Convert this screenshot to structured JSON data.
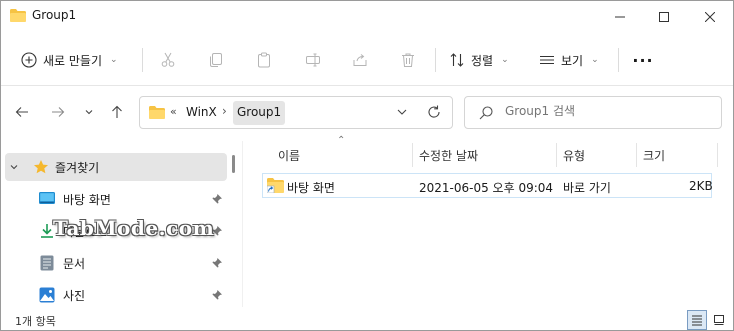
{
  "window": {
    "title": "Group1"
  },
  "toolbar": {
    "new_label": "새로 만들기",
    "sort_label": "정렬",
    "view_label": "보기",
    "more_label": "···"
  },
  "address": {
    "overflow": "«",
    "segment1": "WinX",
    "separator": "›",
    "segment2": "Group1"
  },
  "search": {
    "placeholder": "Group1 검색"
  },
  "sidebar": {
    "items": [
      {
        "label": "즐겨찾기",
        "icon": "star-icon"
      },
      {
        "label": "바탕 화면",
        "icon": "desktop-icon"
      },
      {
        "label": "다운로드",
        "icon": "download-icon"
      },
      {
        "label": "문서",
        "icon": "document-icon"
      },
      {
        "label": "사진",
        "icon": "pictures-icon"
      }
    ]
  },
  "columns": {
    "name": "이름",
    "modified": "수정한 날짜",
    "type": "유형",
    "size": "크기"
  },
  "files": [
    {
      "name": "바탕 화면",
      "modified": "2021-06-05 오후 09:04",
      "type": "바로 가기",
      "size": "2KB"
    }
  ],
  "status": {
    "count": "1개 항목"
  },
  "watermark": "TabMode.com",
  "colors": {
    "folder": "#f6c344",
    "selection": "#e5e5e5",
    "accent": "#0067c0"
  }
}
